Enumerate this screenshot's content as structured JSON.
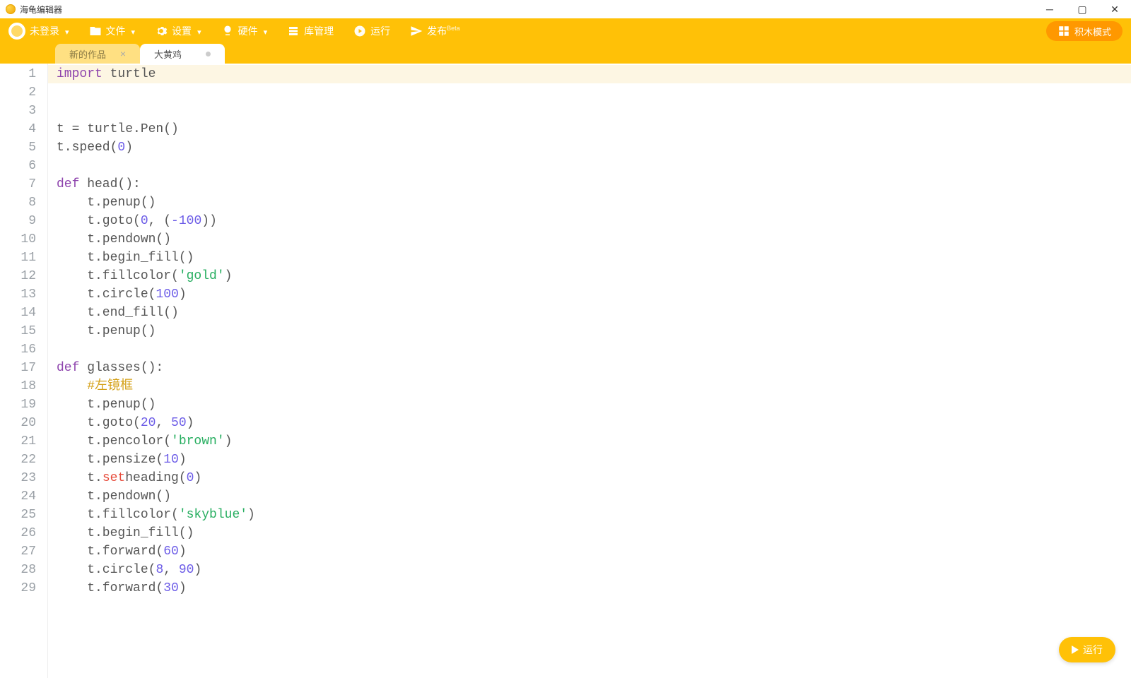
{
  "app": {
    "title": "海龟编辑器"
  },
  "toolbar": {
    "login": "未登录",
    "file": "文件",
    "settings": "设置",
    "hardware": "硬件",
    "library": "库管理",
    "run": "运行",
    "publish": "发布",
    "publish_badge": "Beta",
    "block_mode": "积木模式"
  },
  "tabs": {
    "inactive": "新的作品",
    "active": "大黄鸡"
  },
  "run_fab": "运行",
  "code": {
    "lines": [
      {
        "n": 1,
        "hl": true,
        "tokens": [
          [
            "kw",
            "import"
          ],
          [
            "id",
            " turtle"
          ]
        ]
      },
      {
        "n": 2,
        "tokens": []
      },
      {
        "n": 3,
        "tokens": []
      },
      {
        "n": 4,
        "tokens": [
          [
            "id",
            "t = turtle.Pen()"
          ]
        ]
      },
      {
        "n": 5,
        "tokens": [
          [
            "id",
            "t.speed("
          ],
          [
            "num",
            "0"
          ],
          [
            "id",
            ")"
          ]
        ]
      },
      {
        "n": 6,
        "tokens": []
      },
      {
        "n": 7,
        "tokens": [
          [
            "kw",
            "def"
          ],
          [
            "id",
            " head():"
          ]
        ]
      },
      {
        "n": 8,
        "tokens": [
          [
            "id",
            "    t.penup()"
          ]
        ]
      },
      {
        "n": 9,
        "tokens": [
          [
            "id",
            "    t.goto("
          ],
          [
            "num",
            "0"
          ],
          [
            "id",
            ", ("
          ],
          [
            "num",
            "-100"
          ],
          [
            "id",
            "))"
          ]
        ]
      },
      {
        "n": 10,
        "tokens": [
          [
            "id",
            "    t.pendown()"
          ]
        ]
      },
      {
        "n": 11,
        "tokens": [
          [
            "id",
            "    t.begin_fill()"
          ]
        ]
      },
      {
        "n": 12,
        "tokens": [
          [
            "id",
            "    t.fillcolor("
          ],
          [
            "str",
            "'gold'"
          ],
          [
            "id",
            ")"
          ]
        ]
      },
      {
        "n": 13,
        "tokens": [
          [
            "id",
            "    t.circle("
          ],
          [
            "num",
            "100"
          ],
          [
            "id",
            ")"
          ]
        ]
      },
      {
        "n": 14,
        "tokens": [
          [
            "id",
            "    t.end_fill()"
          ]
        ]
      },
      {
        "n": 15,
        "tokens": [
          [
            "id",
            "    t.penup()"
          ]
        ]
      },
      {
        "n": 16,
        "tokens": []
      },
      {
        "n": 17,
        "tokens": [
          [
            "kw",
            "def"
          ],
          [
            "id",
            " glasses():"
          ]
        ]
      },
      {
        "n": 18,
        "tokens": [
          [
            "id",
            "    "
          ],
          [
            "cmt",
            "#左镜框"
          ]
        ]
      },
      {
        "n": 19,
        "tokens": [
          [
            "id",
            "    t.penup()"
          ]
        ]
      },
      {
        "n": 20,
        "tokens": [
          [
            "id",
            "    t.goto("
          ],
          [
            "num",
            "20"
          ],
          [
            "id",
            ", "
          ],
          [
            "num",
            "50"
          ],
          [
            "id",
            ")"
          ]
        ]
      },
      {
        "n": 21,
        "tokens": [
          [
            "id",
            "    t.pencolor("
          ],
          [
            "str",
            "'brown'"
          ],
          [
            "id",
            ")"
          ]
        ]
      },
      {
        "n": 22,
        "tokens": [
          [
            "id",
            "    t.pensize("
          ],
          [
            "num",
            "10"
          ],
          [
            "id",
            ")"
          ]
        ]
      },
      {
        "n": 23,
        "tokens": [
          [
            "id",
            "    t."
          ],
          [
            "red",
            "set"
          ],
          [
            "id",
            "heading("
          ],
          [
            "num",
            "0"
          ],
          [
            "id",
            ")"
          ]
        ]
      },
      {
        "n": 24,
        "tokens": [
          [
            "id",
            "    t.pendown()"
          ]
        ]
      },
      {
        "n": 25,
        "tokens": [
          [
            "id",
            "    t.fillcolor("
          ],
          [
            "str",
            "'skyblue'"
          ],
          [
            "id",
            ")"
          ]
        ]
      },
      {
        "n": 26,
        "tokens": [
          [
            "id",
            "    t.begin_fill()"
          ]
        ]
      },
      {
        "n": 27,
        "tokens": [
          [
            "id",
            "    t.forward("
          ],
          [
            "num",
            "60"
          ],
          [
            "id",
            ")"
          ]
        ]
      },
      {
        "n": 28,
        "tokens": [
          [
            "id",
            "    t.circle("
          ],
          [
            "num",
            "8"
          ],
          [
            "id",
            ", "
          ],
          [
            "num",
            "90"
          ],
          [
            "id",
            ")"
          ]
        ]
      },
      {
        "n": 29,
        "tokens": [
          [
            "id",
            "    t.forward("
          ],
          [
            "num",
            "30"
          ],
          [
            "id",
            ")"
          ]
        ]
      }
    ]
  }
}
